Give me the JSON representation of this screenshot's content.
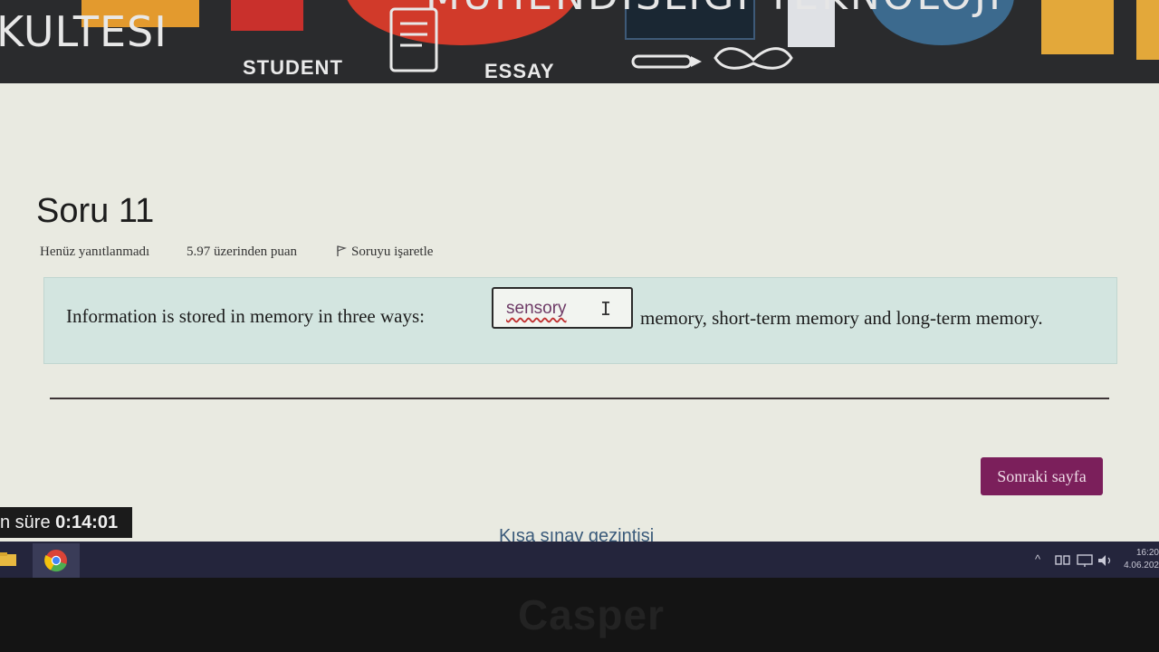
{
  "banner": {
    "top_text": "MÜHENDİSLİĞİ TEKNOLOJİ",
    "title": "KULTESI",
    "word1": "STUDENT",
    "word2": "ESSAY"
  },
  "question": {
    "title": "Soru 11",
    "status": "Henüz yanıtlanmadı",
    "points": "5.97 üzerinden puan",
    "flag_label": "Soruyu işaretle",
    "text_before": "Information is stored in memory in three ways:",
    "answer_value": "sensory",
    "text_after": "memory, short-term memory and long-term memory."
  },
  "navigation": {
    "next_button": "Sonraki sayfa",
    "quiz_nav": "Kısa sınav gezintisi"
  },
  "timer": {
    "label": "n süre",
    "value": "0:14:01"
  },
  "taskbar": {
    "time": "16:20",
    "date": "4.06.202"
  },
  "bezel": {
    "brand": "Casper"
  },
  "colors": {
    "accent": "#7b1f5b",
    "question_bg": "#d3e5e0",
    "page_bg": "#e9eae1"
  }
}
